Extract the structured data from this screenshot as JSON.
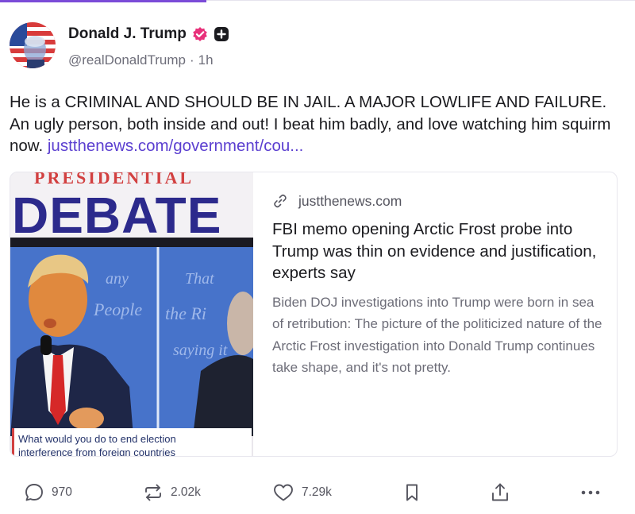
{
  "author": {
    "display_name": "Donald J. Trump",
    "handle": "@realDonaldTrump",
    "separator": "·",
    "time": "1h"
  },
  "post": {
    "text": "He is a CRIMINAL AND SHOULD BE IN JAIL. A MAJOR LOWLIFE AND FAILURE. An ugly person, both inside and out! I beat him badly, and love watching him squirm now.",
    "link": "justthenews.com/government/cou..."
  },
  "link_card": {
    "image_banner": "DEBATE",
    "image_banner_top": "PRESIDENTIAL",
    "image_caption_1": "What would you do to end election",
    "image_caption_2": "interference from foreign countries",
    "domain": "justthenews.com",
    "title": "FBI memo opening Arctic Frost probe into Trump was thin on evidence and justification, experts say",
    "description": "Biden DOJ investigations into Trump were born in sea of retribution: The picture of the politicized nature of the Arctic Frost investigation into Donald Trump continues take shape, and it's not pretty."
  },
  "actions": {
    "replies": "970",
    "reposts": "2.02k",
    "likes": "7.29k"
  },
  "icons": {
    "verified": "verified-badge-icon",
    "follow": "plus-square-icon",
    "link": "link-icon",
    "reply": "reply-bubble-icon",
    "repost": "repost-icon",
    "like": "heart-icon",
    "bookmark": "bookmark-icon",
    "share": "share-icon",
    "more": "more-dots-icon"
  },
  "colors": {
    "accent": "#7b4bd8",
    "link": "#5b3fd0",
    "verified": "#e8317a"
  }
}
